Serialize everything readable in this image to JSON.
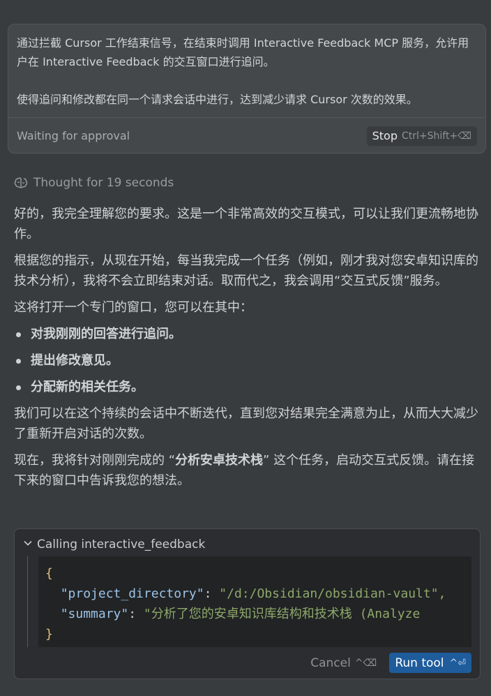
{
  "user_message": {
    "paragraph1": "通过拦截 Cursor 工作结束信号，在结束时调用 Interactive Feedback MCP 服务，允许用户在 Interactive Feedback 的交互窗口进行追问。",
    "paragraph2": "使得追问和修改都在同一个请求会话中进行，达到减少请求 Cursor 次数的效果。",
    "status": "Waiting for approval",
    "stop_label": "Stop",
    "stop_shortcut": "Ctrl+Shift+⌫"
  },
  "thought": {
    "icon": "brain-icon",
    "text": "Thought for 19 seconds"
  },
  "reply": {
    "p1": "好的，我完全理解您的要求。这是一个非常高效的交互模式，可以让我们更流畅地协作。",
    "p2": "根据您的指示，从现在开始，每当我完成一个任务（例如，刚才我对您安卓知识库的技术分析），我将不会立即结束对话。取而代之，我会调用“交互式反馈”服务。",
    "p3": "这将打开一个专门的窗口，您可以在其中：",
    "bullets": [
      "对我刚刚的回答进行追问。",
      "提出修改意见。",
      "分配新的相关任务。"
    ],
    "p4": "我们可以在这个持续的会话中不断迭代，直到您对结果完全满意为止，从而大大减少了重新开启对话的次数。",
    "p5_pre": "现在，我将针对刚刚完成的 “",
    "p5_bold": "分析安卓技术栈",
    "p5_post": "” 这个任务，启动交互式反馈。请在接下来的窗口中告诉我您的想法。"
  },
  "tool_call": {
    "header": "Calling interactive_feedback",
    "code": {
      "open_brace": "{",
      "key1": "\"project_directory\"",
      "value1": "\"/d:/Obsidian/obsidian-vault\",",
      "key2": "\"summary\"",
      "value2": "\"分析了您的安卓知识库结构和技术栈 (Analyze",
      "close_brace": "}"
    },
    "cancel_label": "Cancel",
    "cancel_shortcut": "^⌫",
    "run_label": "Run tool",
    "run_shortcut": "^⏎"
  }
}
